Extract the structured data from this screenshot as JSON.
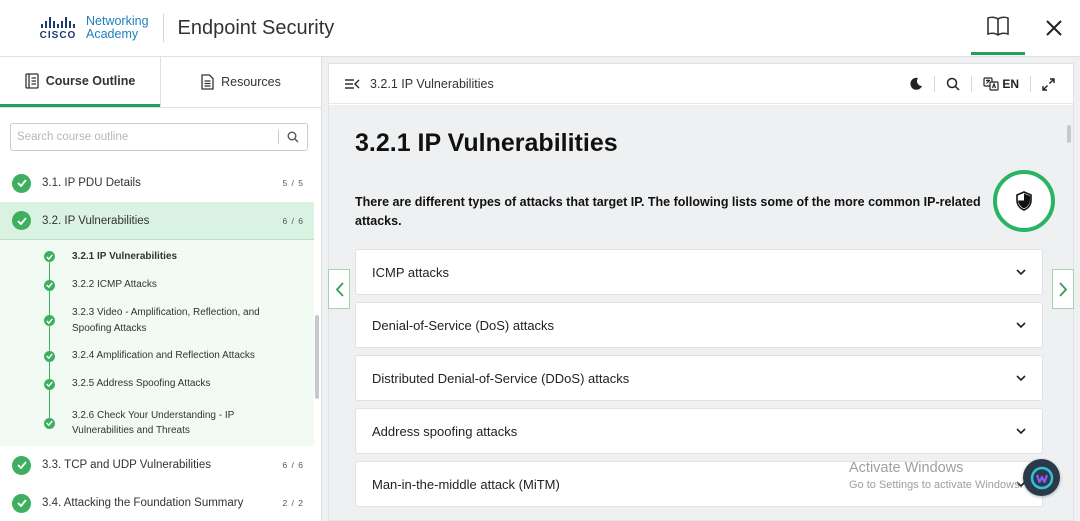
{
  "header": {
    "logo": {
      "brand": "CISCO",
      "line1": "Networking",
      "line2": "Academy"
    },
    "title": "Endpoint Security",
    "icons": {
      "book": "book-icon",
      "close": "close-icon"
    }
  },
  "sidebar": {
    "tabs": [
      {
        "label": "Course Outline",
        "icon": "outline-icon",
        "active": true
      },
      {
        "label": "Resources",
        "icon": "document-icon",
        "active": false
      }
    ],
    "search": {
      "placeholder": "Search course outline",
      "value": ""
    },
    "modules": [
      {
        "label": "3.1. IP PDU Details",
        "count": "5 / 5",
        "complete": true
      },
      {
        "label": "3.2. IP Vulnerabilities",
        "count": "6 / 6",
        "complete": true,
        "active": true,
        "items": [
          {
            "label": "3.2.1 IP Vulnerabilities",
            "current": true
          },
          {
            "label": "3.2.2 ICMP Attacks"
          },
          {
            "label": "3.2.3 Video - Amplification, Reflection, and",
            "label2": "Spoofing Attacks"
          },
          {
            "label": "3.2.4 Amplification and Reflection Attacks"
          },
          {
            "label": "3.2.5 Address Spoofing Attacks"
          },
          {
            "label": "3.2.6 Check Your Understanding - IP",
            "label2": "Vulnerabilities and Threats"
          }
        ]
      },
      {
        "label": "3.3. TCP and UDP Vulnerabilities",
        "count": "6 / 6",
        "complete": true
      },
      {
        "label": "3.4. Attacking the Foundation Summary",
        "count": "2 / 2",
        "complete": true
      }
    ]
  },
  "main": {
    "breadcrumb": "3.2.1 IP Vulnerabilities",
    "toolbar": {
      "language": "EN",
      "icons": [
        "moon-icon",
        "search-icon",
        "translate-icon",
        "expand-icon"
      ]
    },
    "title": "3.2.1 IP Vulnerabilities",
    "intro": "There are different types of attacks that target IP. The following lists some of the more common IP-related attacks.",
    "accordion": [
      "ICMP attacks",
      "Denial-of-Service (DoS) attacks",
      "Distributed Denial-of-Service (DDoS) attacks",
      "Address spoofing attacks",
      "Man-in-the-middle attack (MiTM)"
    ]
  },
  "watermark": {
    "title": "Activate Windows",
    "subtitle": "Go to Settings to activate Windows."
  },
  "colors": {
    "accent": "#22a05a",
    "check": "#3cb060",
    "active_row": "#d9f2e1",
    "brand": "#1a3c6e",
    "link": "#1f7fc1"
  }
}
